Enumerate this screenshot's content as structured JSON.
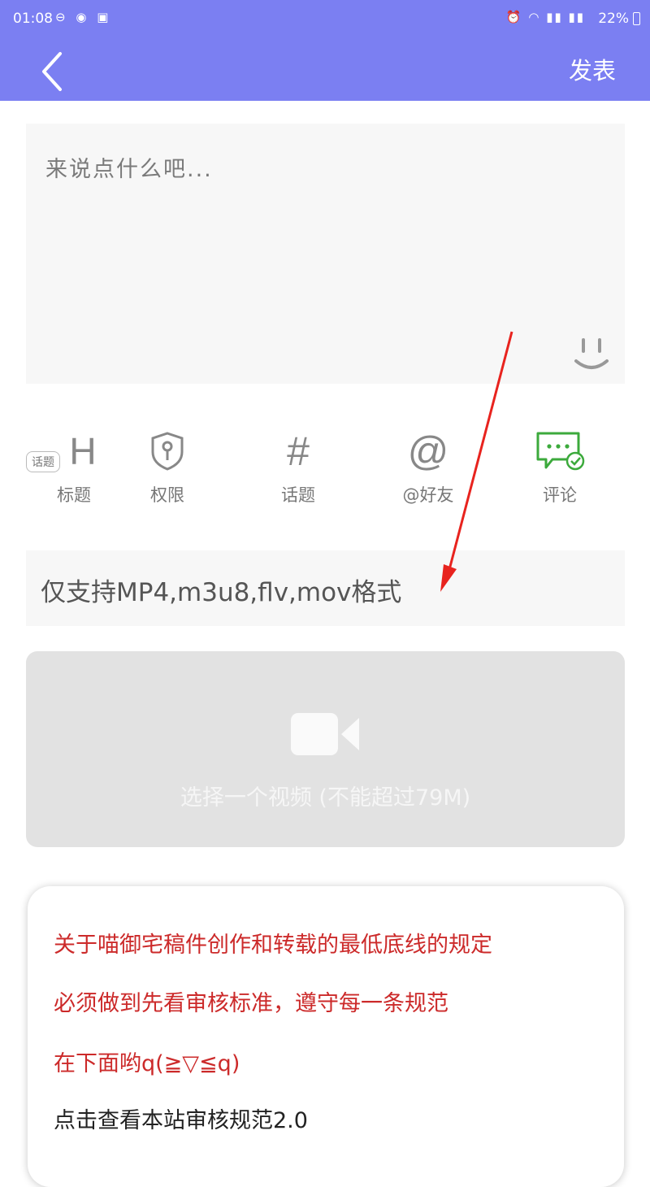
{
  "status_bar": {
    "time": "01:08",
    "battery": "22%"
  },
  "header": {
    "publish_label": "发表"
  },
  "compose": {
    "placeholder": "来说点什么吧..."
  },
  "toolbar": {
    "topic_tag": "话题",
    "items": [
      {
        "label": "标题",
        "icon": "title-h-icon"
      },
      {
        "label": "权限",
        "icon": "permission-shield-icon"
      },
      {
        "label": "话题",
        "icon": "hashtag-icon"
      },
      {
        "label": "@好友",
        "icon": "at-icon"
      },
      {
        "label": "评论",
        "icon": "comment-icon"
      }
    ]
  },
  "format_note": "仅支持MP4,m3u8,flv,mov格式",
  "video_picker": {
    "label": "选择一个视频 (不能超过79M)"
  },
  "notice": {
    "lines": [
      "关于喵御宅稿件创作和转载的最低底线的规定",
      "必须做到先看审核标准，遵守每一条规范",
      "在下面哟q(≧▽≦q)"
    ],
    "link": "点击查看本站审核规范2.0"
  },
  "colors": {
    "header": "#7b7ff2",
    "notice_red": "#cc2a2a",
    "comment_green": "#3caa3c",
    "annotation_arrow": "#e8231e"
  }
}
